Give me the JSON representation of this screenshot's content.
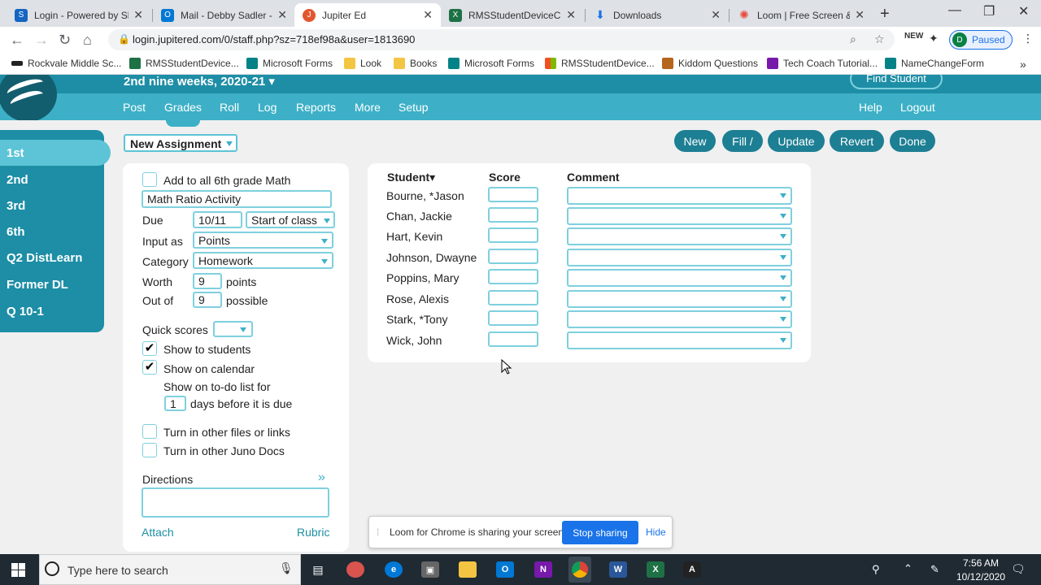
{
  "browser": {
    "tabs": [
      {
        "title": "Login - Powered by Sky",
        "color": "#1565c0"
      },
      {
        "title": "Mail - Debby Sadler - C",
        "color": "#0078d4"
      },
      {
        "title": "Jupiter Ed",
        "color": "#e2562e"
      },
      {
        "title": "RMSStudentDeviceChec",
        "color": "#1e7145"
      },
      {
        "title": "Downloads",
        "color": "#1a73e8"
      },
      {
        "title": "Loom | Free Screen & V",
        "color": "#e84b3c"
      }
    ],
    "url": "login.jupitered.com/0/staff.php?sz=718ef98a&user=1813690",
    "profile_initial": "D",
    "profile_status": "Paused",
    "bookmarks": [
      {
        "label": "Rockvale Middle Sc...",
        "color": "#222222"
      },
      {
        "label": "RMSStudentDevice...",
        "color": "#1e7145"
      },
      {
        "label": "Microsoft Forms",
        "color": "#038387"
      },
      {
        "label": "Look",
        "color": "#f4c542"
      },
      {
        "label": "Books",
        "color": "#f4c542"
      },
      {
        "label": "Microsoft Forms",
        "color": "#038387"
      },
      {
        "label": "RMSStudentDevice...",
        "color": "#f25022"
      },
      {
        "label": "Kiddom Questions",
        "color": "#b5651d"
      },
      {
        "label": "Tech Coach Tutorial...",
        "color": "#7719aa"
      },
      {
        "label": "NameChangeForm",
        "color": "#038387"
      }
    ]
  },
  "header": {
    "term": "2nd nine weeks, 2020-21 ▾",
    "find_student": "Find Student",
    "nav": [
      "Post",
      "Grades",
      "Roll",
      "Log",
      "Reports",
      "More",
      "Setup"
    ],
    "help": "Help",
    "logout": "Logout"
  },
  "sidebar": {
    "items": [
      "1st",
      "2nd",
      "3rd",
      "6th",
      "Q2 DistLearn",
      "Former DL",
      "Q 10-1"
    ]
  },
  "assignment_select": "New Assignment",
  "actions": [
    "New",
    "Fill /",
    "Update",
    "Revert",
    "Done"
  ],
  "form": {
    "add_all_label": "Add to all 6th grade Math",
    "name_value": "Math Ratio Activity",
    "due_label": "Due",
    "due_date": "10/11",
    "due_time": "Start of class",
    "input_as_label": "Input as",
    "input_as": "Points",
    "category_label": "Category",
    "category": "Homework",
    "worth_label": "Worth",
    "worth": "9",
    "worth_unit": "points",
    "outof_label": "Out of",
    "outof": "9",
    "outof_unit": "possible",
    "quick_scores_label": "Quick scores",
    "show_students_label": "Show to students",
    "show_calendar_label": "Show on calendar",
    "todo_label": "Show on to-do list for",
    "todo_days": "1",
    "todo_suffix": "days before it is due",
    "turnin_files_label": "Turn in other files or links",
    "turnin_juno_label": "Turn in other Juno Docs",
    "directions_label": "Directions",
    "attach": "Attach",
    "rubric": "Rubric"
  },
  "grades": {
    "col_student": "Student▾",
    "col_score": "Score",
    "col_comment": "Comment",
    "students": [
      "Bourne, *Jason",
      "Chan, Jackie",
      "Hart, Kevin",
      "Johnson, Dwayne",
      "Poppins, Mary",
      "Rose, Alexis",
      "Stark, *Tony",
      "Wick, John"
    ]
  },
  "loom": {
    "message": "Loom for Chrome is sharing your screen.",
    "stop": "Stop sharing",
    "hide": "Hide"
  },
  "taskbar": {
    "search_placeholder": "Type here to search",
    "time": "7:56 AM",
    "date": "10/12/2020"
  },
  "colors": {
    "header_dark": "#1d8ea6",
    "header_light": "#3db0c7",
    "button": "#1d7f93",
    "input_border": "#7fd0de"
  }
}
